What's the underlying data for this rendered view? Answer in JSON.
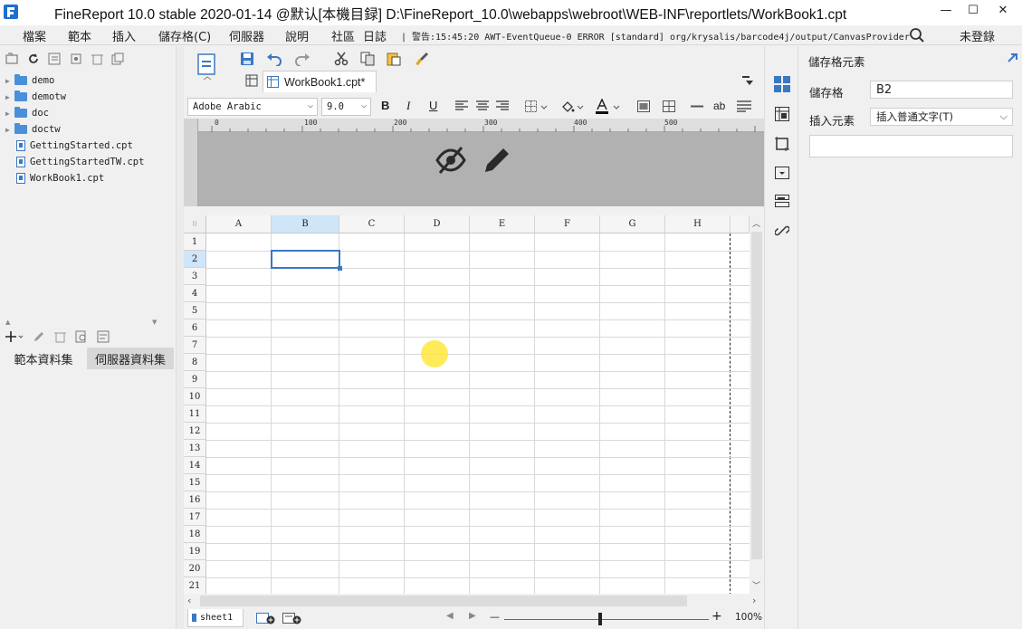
{
  "window": {
    "title": "FineReport 10.0 stable 2020-01-14 @默认[本機目録]   D:\\FineReport_10.0\\webapps\\webroot\\WEB-INF\\reportlets/WorkBook1.cpt",
    "minimize": "—",
    "maximize": "☐",
    "close": "✕"
  },
  "menu": {
    "items": [
      "檔案",
      "範本",
      "插入",
      "儲存格(C)",
      "伺服器",
      "說明",
      "社區",
      "日誌"
    ],
    "log_text": "| 警告:15:45:20 AWT-EventQueue-0 ERROR [standard] org/krysalis/barcode4j/output/CanvasProvider",
    "login": "未登錄"
  },
  "tree": {
    "folders": [
      "demo",
      "demotw",
      "doc",
      "doctw"
    ],
    "files": [
      "GettingStarted.cpt",
      "GettingStartedTW.cpt",
      "WorkBook1.cpt"
    ]
  },
  "dataset_tabs": [
    "範本資料集",
    "伺服器資料集"
  ],
  "editor": {
    "file_tab": "WorkBook1.cpt*",
    "font_name": "Adobe Arabic",
    "font_size": "9.0",
    "bold": "B",
    "italic": "I",
    "underline": "U",
    "text_ab": "ab",
    "ruler_labels": [
      "0",
      "100",
      "200",
      "300",
      "400",
      "500"
    ]
  },
  "grid": {
    "columns": [
      "A",
      "B",
      "C",
      "D",
      "E",
      "F",
      "G",
      "H"
    ],
    "rows": [
      "1",
      "2",
      "3",
      "4",
      "5",
      "6",
      "7",
      "8",
      "9",
      "10",
      "11",
      "12",
      "13",
      "14",
      "15",
      "16",
      "17",
      "18",
      "19",
      "20",
      "21"
    ]
  },
  "status": {
    "sheet": "sheet1",
    "zoom": "100%",
    "minus": "—",
    "plus": "+"
  },
  "properties": {
    "title": "儲存格元素",
    "cell_label": "儲存格",
    "cell_value": "B2",
    "insert_label": "插入元素",
    "insert_value": "插入普通文字(T)"
  },
  "colors": {
    "accent": "#3a78c2",
    "preview_bg": "#b1b1b1",
    "cursor": "#ffe83c"
  }
}
